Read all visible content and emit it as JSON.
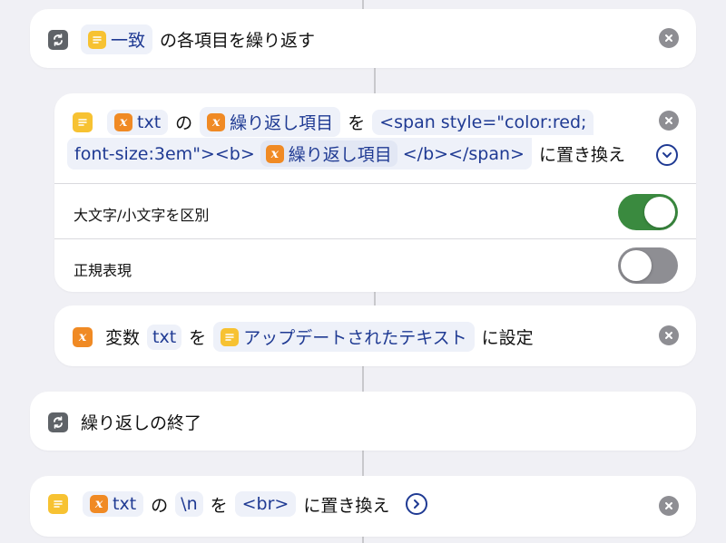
{
  "colors": {
    "background": "#f0f0f5",
    "card": "#ffffff",
    "pill_bg": "#eef1f9",
    "pill_text": "#1f3a93",
    "text_icon": "#f7c232",
    "var_icon": "#f08a24",
    "repeat_icon": "#5f6368",
    "toggle_on": "#3a8a3f",
    "toggle_off": "#8e8e93"
  },
  "repeat_each": {
    "icon": "repeat-icon",
    "token": "一致",
    "text": "の各項目を繰り返す"
  },
  "replace_action": {
    "icon": "text-icon",
    "var1": "txt",
    "particle1": "の",
    "var2": "繰り返し項目",
    "particle2": "を",
    "pattern_line1": "<span style=\"color:red;",
    "pattern_line2": "font-size:3em\"><b>",
    "var3": "繰り返し項目",
    "pattern_end": "</b></span>",
    "suffix": "に置き換え",
    "options": {
      "case_sensitive_label": "大文字/小文字を区別",
      "case_sensitive_value": true,
      "regex_label": "正規表現",
      "regex_value": false
    }
  },
  "set_variable": {
    "icon": "variable-icon",
    "label": "変数",
    "var_name": "txt",
    "particle": "を",
    "value": "アップデートされたテキスト",
    "suffix": "に設定"
  },
  "end_repeat": {
    "icon": "repeat-icon",
    "label": "繰り返しの終了"
  },
  "replace_newline": {
    "icon": "text-icon",
    "var": "txt",
    "particle1": "の",
    "find": "\\n",
    "particle2": "を",
    "replace": "<br>",
    "suffix": "に置き換え"
  },
  "icons": {
    "var_glyph": "x"
  }
}
